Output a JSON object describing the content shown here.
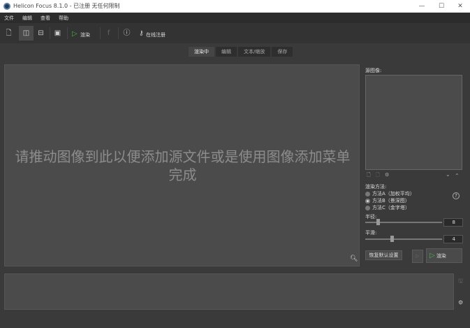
{
  "window": {
    "title": "Helicon Focus 8.1.0 - 已注册 无任何限制",
    "minimize": "—",
    "maximize": "☐",
    "close": "✕"
  },
  "menu": [
    "文件",
    "编辑",
    "查看",
    "帮助"
  ],
  "toolbar": {
    "render_label": "渲染",
    "register_label": "在线注册"
  },
  "tabs": [
    "渲染中",
    "编辑",
    "文本/缩放",
    "保存"
  ],
  "viewer": {
    "message": "请推动图像到此以便添加源文件或是使用图像添加菜单完成"
  },
  "sidebar": {
    "source_label": "源图像:",
    "method_label": "渲染方法:",
    "methods": [
      {
        "label": "方法A（加权平均）",
        "selected": false
      },
      {
        "label": "方法B（景深图）",
        "selected": true
      },
      {
        "label": "方法C（金字塔）",
        "selected": false
      }
    ],
    "radius_label": "半径:",
    "radius_value": "8",
    "smoothing_label": "平滑:",
    "smoothing_value": "4",
    "reset_label": "恢复默认设置",
    "render_label": "渲染"
  }
}
